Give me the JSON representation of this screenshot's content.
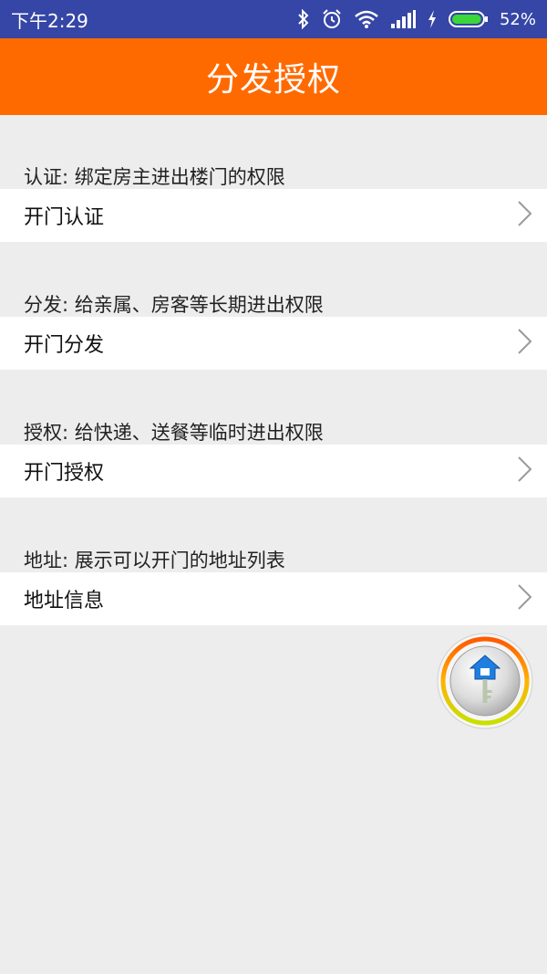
{
  "status_bar": {
    "time": "下午2:29",
    "battery": "52%",
    "battery_level": 0.52,
    "icons": [
      "bluetooth-icon",
      "alarm-icon",
      "wifi-icon",
      "signal-icon",
      "charging-icon",
      "battery-icon"
    ]
  },
  "header": {
    "title": "分发授权"
  },
  "sections": [
    {
      "description": "认证: 绑定房主进出楼门的权限",
      "item": "开门认证"
    },
    {
      "description": "分发: 给亲属、房客等长期进出权限",
      "item": "开门分发"
    },
    {
      "description": "授权: 给快递、送餐等临时进出权限",
      "item": "开门授权"
    },
    {
      "description": "地址: 展示可以开门的地址列表",
      "item": "地址信息"
    }
  ],
  "colors": {
    "status_bar": "#3546a6",
    "header": "#ff6a00",
    "background": "#ededed",
    "row": "#ffffff"
  },
  "fab": {
    "icon": "house-key-icon"
  }
}
